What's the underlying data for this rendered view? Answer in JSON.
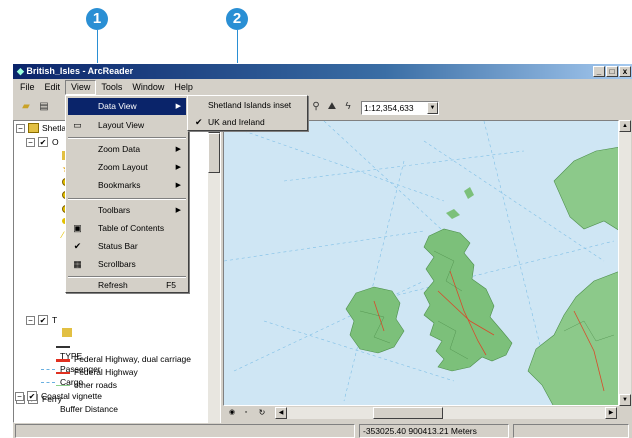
{
  "callouts": {
    "one": "1",
    "two": "2"
  },
  "window": {
    "title": "British_Isles - ArcReader",
    "controls": {
      "minimize": "_",
      "maximize": "□",
      "close": "x"
    }
  },
  "menubar": [
    "File",
    "Edit",
    "View",
    "Tools",
    "Window",
    "Help"
  ],
  "toolbar": {
    "scale": "1:12,354,633"
  },
  "view_menu": {
    "items": [
      {
        "label": "Data View",
        "submenu": true,
        "highlighted": true
      },
      {
        "label": "Layout View",
        "icon": "layout-view-icon"
      },
      {
        "label": "Zoom Data",
        "submenu": true
      },
      {
        "label": "Zoom Layout",
        "submenu": true
      },
      {
        "label": "Bookmarks",
        "submenu": true
      },
      {
        "label": "Toolbars",
        "submenu": true
      },
      {
        "label": "Table of Contents",
        "icon": "table-of-contents-icon"
      },
      {
        "label": "Status Bar",
        "checked": true
      },
      {
        "label": "Scrollbars",
        "icon": "scrollbars-icon"
      },
      {
        "label": "Refresh",
        "shortcut": "F5"
      }
    ]
  },
  "data_view_submenu": {
    "items": [
      {
        "label": "Shetland Islands inset",
        "checked": false
      },
      {
        "label": "UK and Ireland",
        "checked": true
      }
    ]
  },
  "toc": {
    "root_label": "Shetla",
    "group2_label": "O",
    "group3_label": "T",
    "legend_roads": [
      {
        "label": "Federal Highway, dual carriage",
        "color": "#e03020"
      },
      {
        "label": "Federal Highway",
        "color": "#e03020"
      },
      {
        "label": "other roads",
        "color": "#8cd08c"
      }
    ],
    "ferry": {
      "label": "Ferry",
      "field": "TYPE",
      "items": [
        {
          "label": "Passenger",
          "color": "#6ab0e0"
        },
        {
          "label": "Cargo",
          "color": "#6ab0e0"
        }
      ]
    },
    "coastal": {
      "label": "Coastal vignette",
      "field": "Buffer Distance"
    }
  },
  "status_bar": {
    "coordinates": "-353025.40  900413.21 Meters"
  },
  "colors": {
    "sea": "#cfe6f4",
    "land": "#7cc07a",
    "highlight": "#0a246a",
    "callout": "#2a8fd4"
  }
}
